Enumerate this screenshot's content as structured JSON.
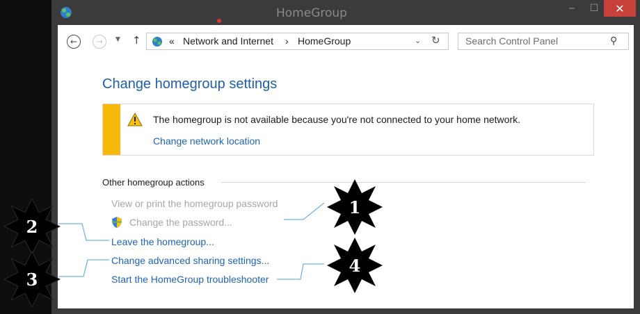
{
  "window": {
    "title": "HomeGroup",
    "minimize": "‒",
    "maximize": "☐",
    "close": "✕"
  },
  "nav": {
    "back_icon": "back-arrow",
    "forward_icon": "forward-arrow",
    "history_icon": "chevron-down",
    "up_icon": "up-arrow",
    "address_prefix": "«",
    "breadcrumb": [
      "Network and Internet",
      "HomeGroup"
    ],
    "separator": "›",
    "refresh_icon": "refresh",
    "search_placeholder": "Search Control Panel"
  },
  "main": {
    "heading": "Change homegroup settings",
    "banner": {
      "message": "The homegroup is not available because you're not connected to your home network.",
      "link": "Change network location",
      "accent_color": "#f6b80a"
    },
    "section_label": "Other homegroup actions",
    "actions": [
      {
        "label": "View or print the homegroup password",
        "enabled": false
      },
      {
        "label": "Change the password...",
        "enabled": false
      },
      {
        "label": "Leave the homegroup...",
        "enabled": true
      },
      {
        "label": "Change advanced sharing settings...",
        "enabled": true
      },
      {
        "label": "Start the HomeGroup troubleshooter",
        "enabled": true
      }
    ]
  },
  "callouts": [
    "1",
    "2",
    "3",
    "4"
  ],
  "colors": {
    "link": "#1e64b4",
    "heading": "#1e5fa8",
    "close_button": "#c7403a",
    "callout_line": "#4aa3df"
  }
}
